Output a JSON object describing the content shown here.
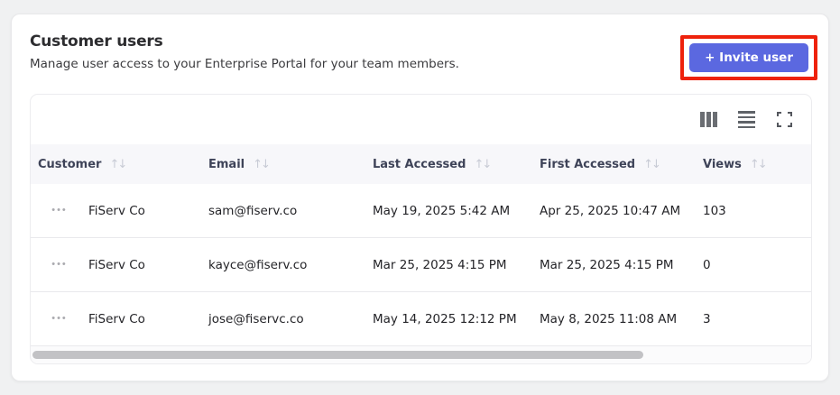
{
  "header": {
    "title": "Customer users",
    "subtitle": "Manage user access to your Enterprise Portal for your team members.",
    "invite_button_label": "+ Invite user"
  },
  "toolbar": {
    "icons": [
      "columns-icon",
      "row-density-icon",
      "fullscreen-icon"
    ]
  },
  "icons": {
    "sort_glyph": "↑↓",
    "row_actions_glyph": "•••"
  },
  "table": {
    "columns": [
      {
        "label": "Customer",
        "sortable": true
      },
      {
        "label": "Email",
        "sortable": true
      },
      {
        "label": "Last Accessed",
        "sortable": true
      },
      {
        "label": "First Accessed",
        "sortable": true
      },
      {
        "label": "Views",
        "sortable": true
      }
    ],
    "rows": [
      {
        "customer": "FiServ Co",
        "email": "sam@fiserv.co",
        "last_accessed": "May 19, 2025 5:42 AM",
        "first_accessed": "Apr 25, 2025 10:47 AM",
        "views": "103"
      },
      {
        "customer": "FiServ Co",
        "email": "kayce@fiserv.co",
        "last_accessed": "Mar 25, 2025 4:15 PM",
        "first_accessed": "Mar 25, 2025 4:15 PM",
        "views": "0"
      },
      {
        "customer": "FiServ Co",
        "email": "jose@fiservc.co",
        "last_accessed": "May 14, 2025 12:12 PM",
        "first_accessed": "May 8, 2025 11:08 AM",
        "views": "3"
      }
    ]
  },
  "colors": {
    "accent": "#5b68e0",
    "highlight": "#ee220c",
    "header_bg": "#f7f7fa",
    "header_text": "#3e4358"
  }
}
